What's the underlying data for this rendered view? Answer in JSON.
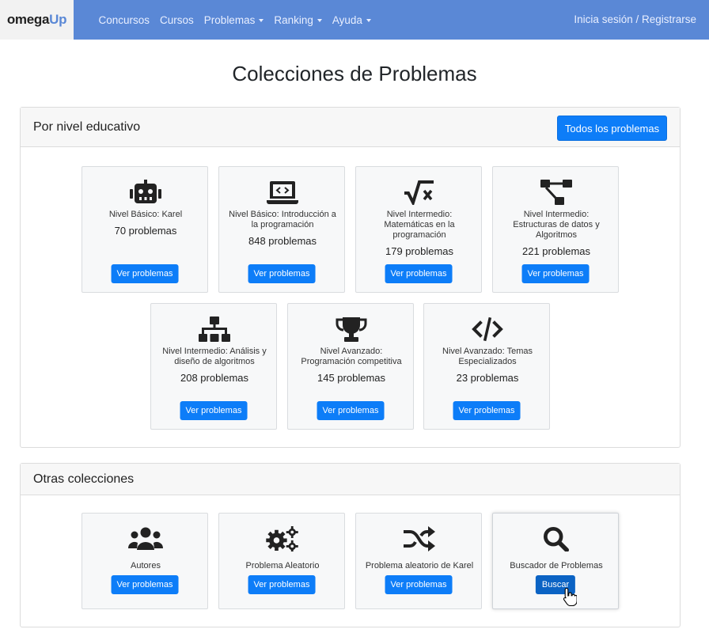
{
  "nav": {
    "logo_part1": "omega",
    "logo_part2": "Up",
    "links": [
      "Concursos",
      "Cursos",
      "Problemas",
      "Ranking",
      "Ayuda"
    ],
    "login": "Inicia sesión / Registrarse"
  },
  "page_title": "Colecciones de Problemas",
  "educational": {
    "title": "Por nivel educativo",
    "all_button": "Todos los problemas",
    "cards": [
      {
        "icon": "robot-icon",
        "label": "Nivel Básico: Karel",
        "count": "70 problemas",
        "button": "Ver problemas"
      },
      {
        "icon": "laptop-code-icon",
        "label": "Nivel Básico: Introducción a la programación",
        "count": "848 problemas",
        "button": "Ver problemas"
      },
      {
        "icon": "square-root-icon",
        "label": "Nivel Intermedio: Matemáticas en la programación",
        "count": "179 problemas",
        "button": "Ver problemas"
      },
      {
        "icon": "project-diagram-icon",
        "label": "Nivel Intermedio: Estructuras de datos y Algoritmos",
        "count": "221 problemas",
        "button": "Ver problemas"
      },
      {
        "icon": "sitemap-icon",
        "label": "Nivel Intermedio: Análisis y diseño de algoritmos",
        "count": "208 problemas",
        "button": "Ver problemas"
      },
      {
        "icon": "trophy-icon",
        "label": "Nivel Avanzado: Programación competitiva",
        "count": "145 problemas",
        "button": "Ver problemas"
      },
      {
        "icon": "code-icon",
        "label": "Nivel Avanzado: Temas Especializados",
        "count": "23 problemas",
        "button": "Ver problemas"
      }
    ]
  },
  "others": {
    "title": "Otras colecciones",
    "cards": [
      {
        "icon": "users-icon",
        "label": "Autores",
        "button": "Ver problemas"
      },
      {
        "icon": "cogs-icon",
        "label": "Problema Aleatorio",
        "button": "Ver problemas"
      },
      {
        "icon": "random-icon",
        "label": "Problema aleatorio de Karel",
        "button": "Ver problemas"
      },
      {
        "icon": "search-icon",
        "label": "Buscador de Problemas",
        "button": "Buscar"
      }
    ]
  }
}
